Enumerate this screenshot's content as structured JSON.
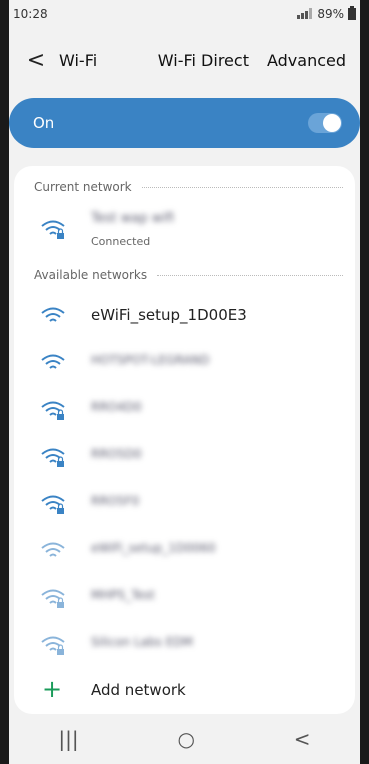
{
  "status_bar": {
    "time": "10:28",
    "battery": "89%"
  },
  "header": {
    "back_label": "<",
    "title": "Wi-Fi",
    "actions": [
      "Wi-Fi Direct",
      "Advanced"
    ]
  },
  "toggle": {
    "label": "On",
    "state": "on",
    "accent": "#3a83c4"
  },
  "current_network": {
    "section_label": "Current network",
    "network": {
      "name": "Test wap wifi",
      "status": "Connected",
      "secured": true
    }
  },
  "available_networks": {
    "section_label": "Available networks",
    "networks": [
      {
        "name": "eWiFi_setup_1D00E3",
        "secured": false,
        "blurred": false
      },
      {
        "name": "HOTSPOT-LEGRAND",
        "secured": false,
        "blurred": true
      },
      {
        "name": "RRO4D0",
        "secured": true,
        "blurred": true
      },
      {
        "name": "RRO5D0",
        "secured": true,
        "blurred": true
      },
      {
        "name": "RRO5F0",
        "secured": true,
        "blurred": true
      },
      {
        "name": "eWiFi_setup_1D0060",
        "secured": false,
        "blurred": true
      },
      {
        "name": "MHPS_Test",
        "secured": true,
        "blurred": true
      },
      {
        "name": "Silicon Labs EDM",
        "secured": true,
        "blurred": true
      }
    ]
  },
  "add_network": {
    "label": "Add network"
  },
  "nav_bar": {
    "recent": "|||",
    "home": "○",
    "back": "<"
  }
}
